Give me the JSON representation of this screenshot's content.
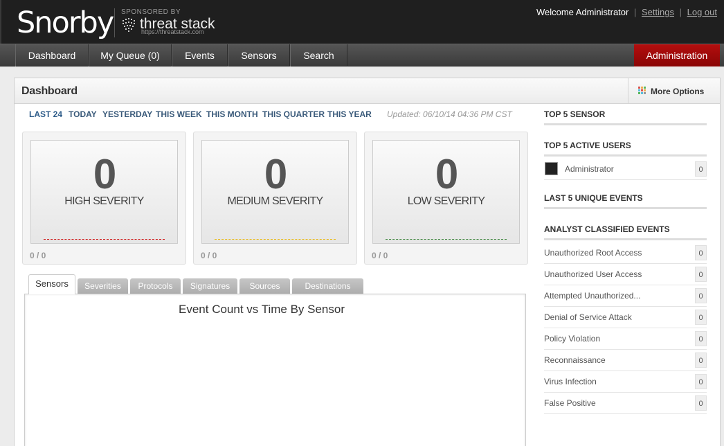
{
  "header": {
    "logo": "Snorby",
    "sponsor_text": "SPONSORED BY",
    "sponsor_name": "threat stack",
    "sponsor_url": "https://threatstack.com",
    "welcome": "Welcome Administrator",
    "settings": "Settings",
    "logout": "Log out",
    "separator": "|"
  },
  "nav": {
    "items": [
      "Dashboard",
      "My Queue (0)",
      "Events",
      "Sensors",
      "Search"
    ],
    "admin": "Administration"
  },
  "panel": {
    "title": "Dashboard",
    "more_options": "More Options"
  },
  "timeframes": [
    "LAST 24",
    "TODAY",
    "YESTERDAY",
    "THIS WEEK",
    "THIS MONTH",
    "THIS QUARTER",
    "THIS YEAR"
  ],
  "updated": "Updated: 06/10/14 04:36 PM CST",
  "severity": [
    {
      "count": "0",
      "label": "HIGH SEVERITY",
      "ratio": "0 / 0",
      "color": "#cc0000"
    },
    {
      "count": "0",
      "label": "MEDIUM SEVERITY",
      "ratio": "0 / 0",
      "color": "#e8b400"
    },
    {
      "count": "0",
      "label": "LOW SEVERITY",
      "ratio": "0 / 0",
      "color": "#2e7d2e"
    }
  ],
  "tabs": [
    "Sensors",
    "Severities",
    "Protocols",
    "Signatures",
    "Sources",
    "Destinations"
  ],
  "chart": {
    "title": "Event Count vs Time By Sensor"
  },
  "sidebar": {
    "top_sensor": "TOP 5 SENSOR",
    "top_users": "TOP 5 ACTIVE USERS",
    "users": [
      {
        "name": "Administrator",
        "count": "0"
      }
    ],
    "unique_events": "LAST 5 UNIQUE EVENTS",
    "classified": "ANALYST CLASSIFIED EVENTS",
    "classifications": [
      {
        "label": "Unauthorized Root Access",
        "count": "0"
      },
      {
        "label": "Unauthorized User Access",
        "count": "0"
      },
      {
        "label": "Attempted Unauthorized...",
        "count": "0"
      },
      {
        "label": "Denial of Service Attack",
        "count": "0"
      },
      {
        "label": "Policy Violation",
        "count": "0"
      },
      {
        "label": "Reconnaissance",
        "count": "0"
      },
      {
        "label": "Virus Infection",
        "count": "0"
      },
      {
        "label": "False Positive",
        "count": "0"
      }
    ]
  }
}
